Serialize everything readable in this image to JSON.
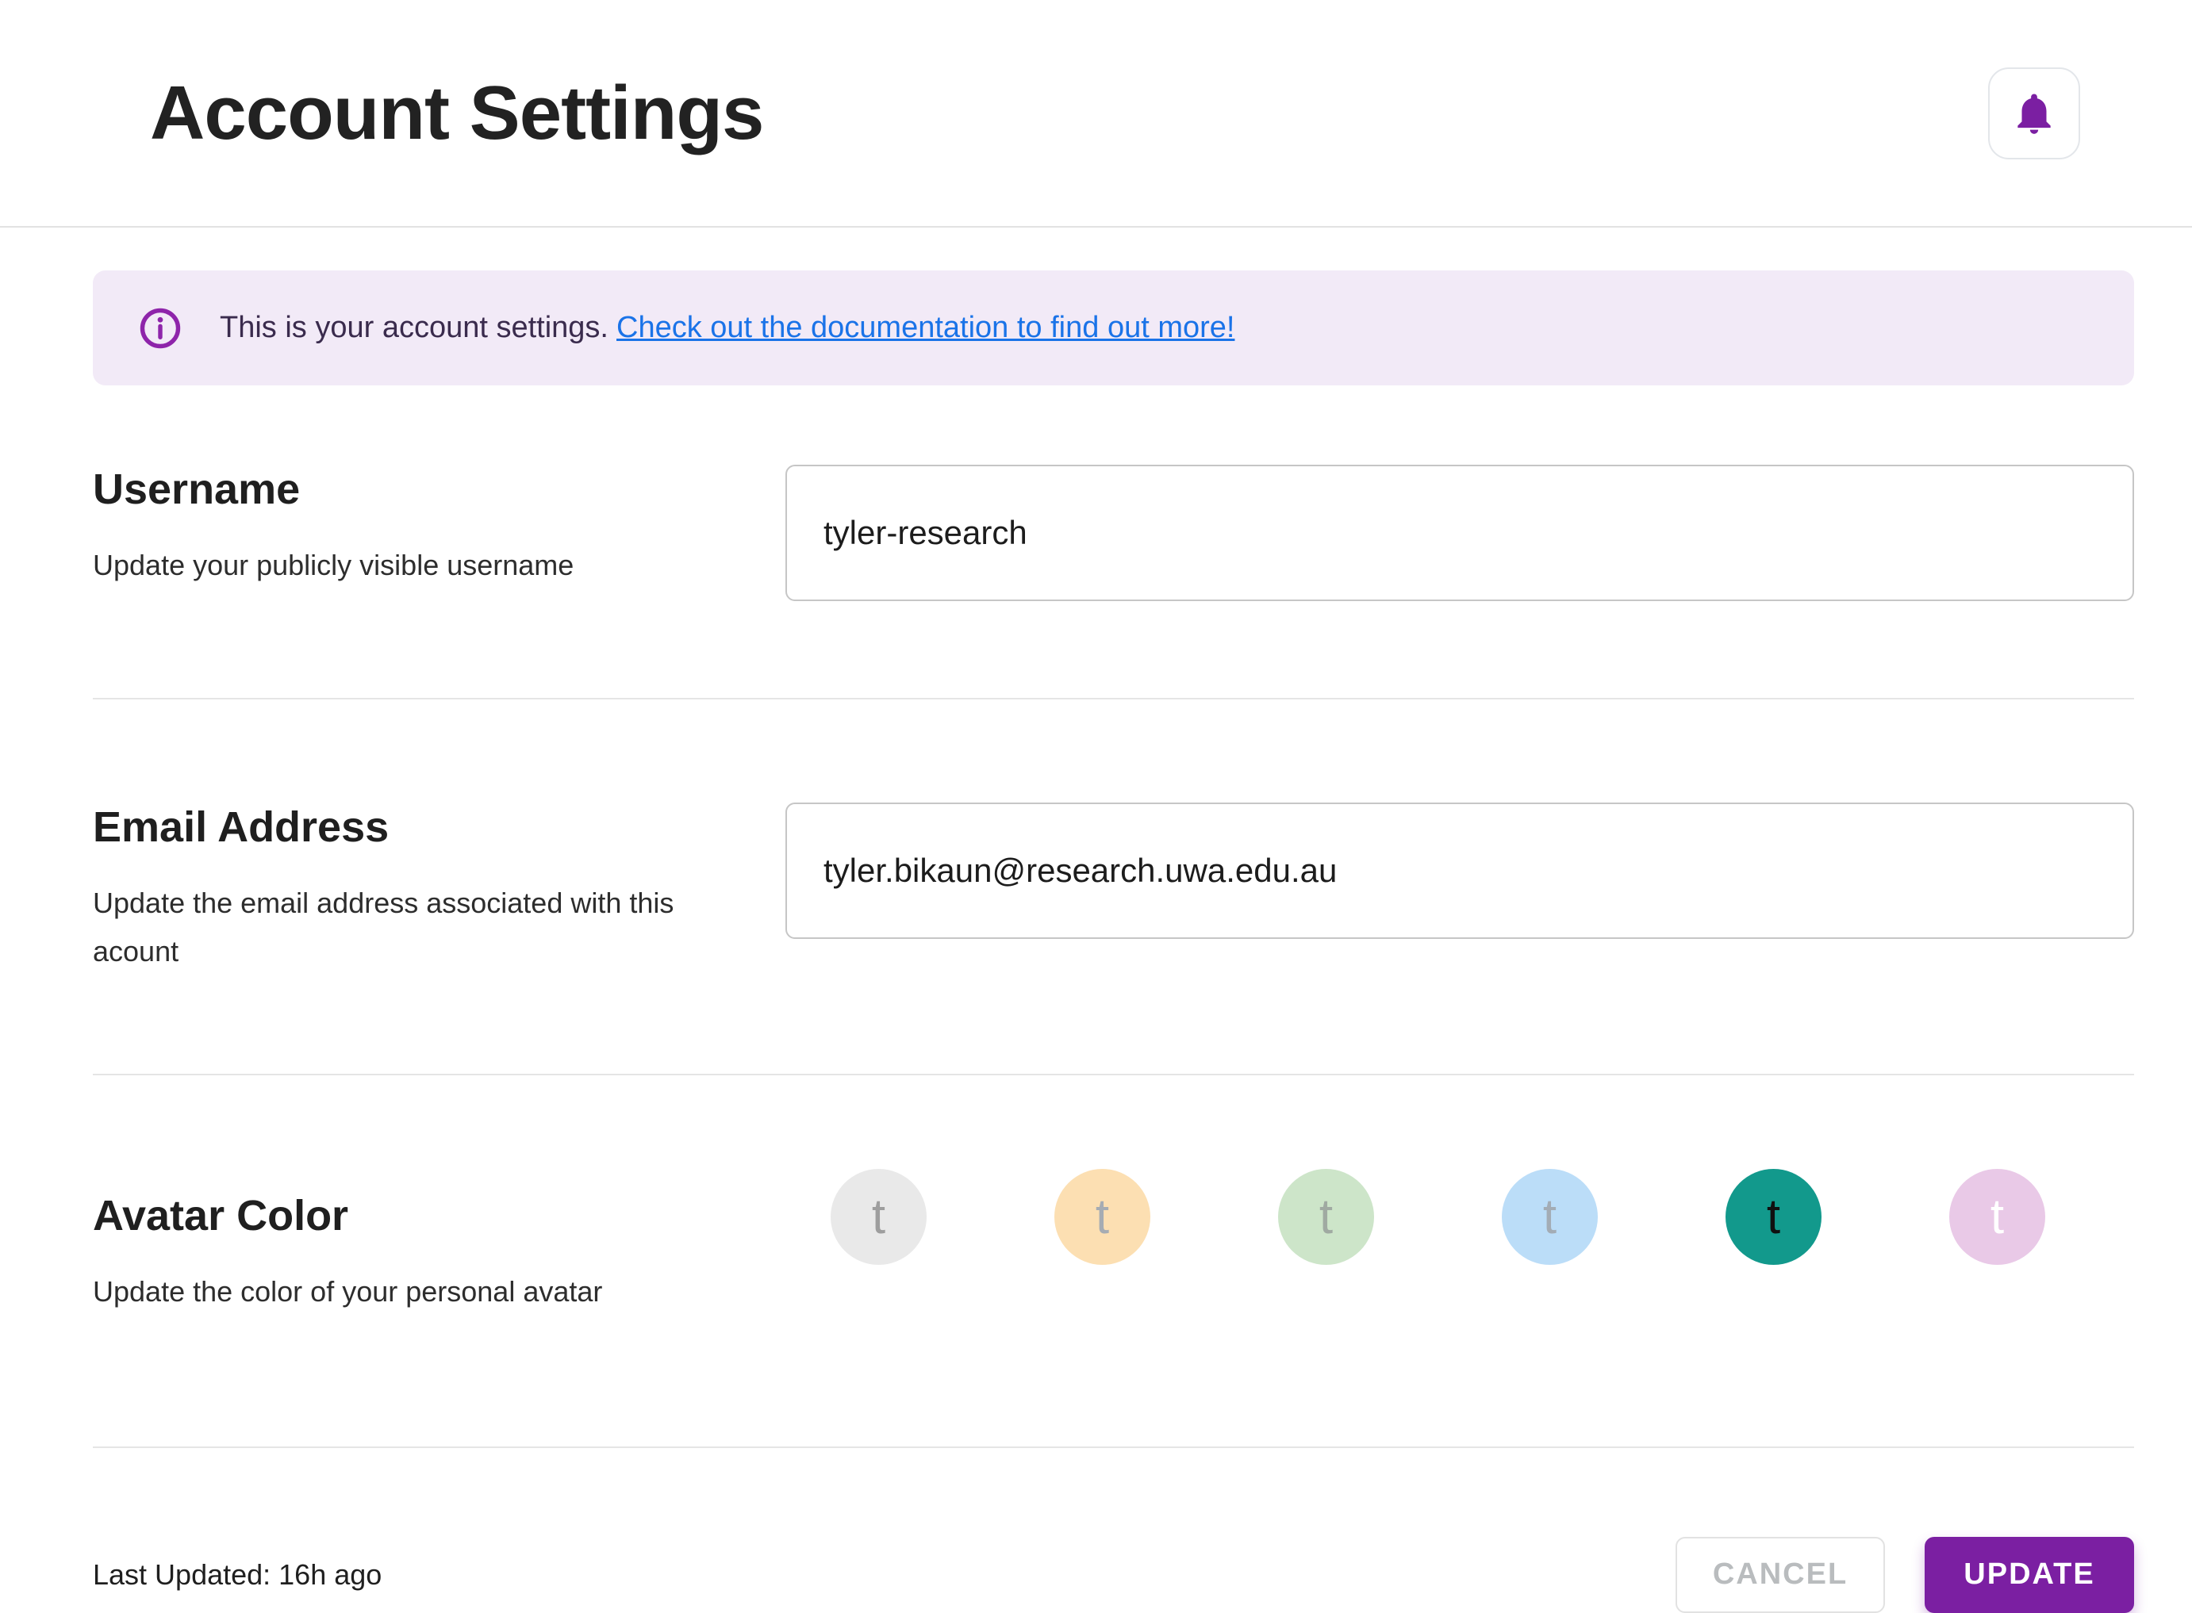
{
  "page": {
    "title": "Account Settings"
  },
  "header": {
    "notifications_icon": "bell-icon",
    "bell_color": "#7B1FA2"
  },
  "banner": {
    "icon": "info-icon",
    "icon_color": "#8E24AA",
    "background": "#F2EAF7",
    "text": "This is your account settings.",
    "link_text": "Check out the documentation to find out more!",
    "link_color": "#1A73E8"
  },
  "sections": {
    "username": {
      "title": "Username",
      "description": "Update your publicly visible username",
      "value": "tyler-research"
    },
    "email": {
      "title": "Email Address",
      "description": "Update the email address associated with this acount",
      "value": "tyler.bikaun@research.uwa.edu.au"
    },
    "avatar": {
      "title": "Avatar Color",
      "description": "Update the color of your personal avatar",
      "options": [
        {
          "name": "gray",
          "letter": "t",
          "bg": "#E9E9E9",
          "fg": "#9E9E9E",
          "selected": false
        },
        {
          "name": "orange",
          "letter": "t",
          "bg": "#FCDFB2",
          "fg": "#A6ACB3",
          "selected": false
        },
        {
          "name": "green",
          "letter": "t",
          "bg": "#CDE5C9",
          "fg": "#A0AAA2",
          "selected": false
        },
        {
          "name": "blue",
          "letter": "t",
          "bg": "#BBDDF8",
          "fg": "#A3ACB5",
          "selected": false
        },
        {
          "name": "teal",
          "letter": "t",
          "bg": "#12998C",
          "fg": "#101010",
          "selected": true
        },
        {
          "name": "pink",
          "letter": "t",
          "bg": "#E9C9E7",
          "fg": "#FFFFFF",
          "selected": false
        }
      ]
    }
  },
  "footer": {
    "last_updated": "Last Updated: 16h ago",
    "cancel_label": "CANCEL",
    "update_label": "UPDATE",
    "accent_color": "#7B1FA2"
  }
}
